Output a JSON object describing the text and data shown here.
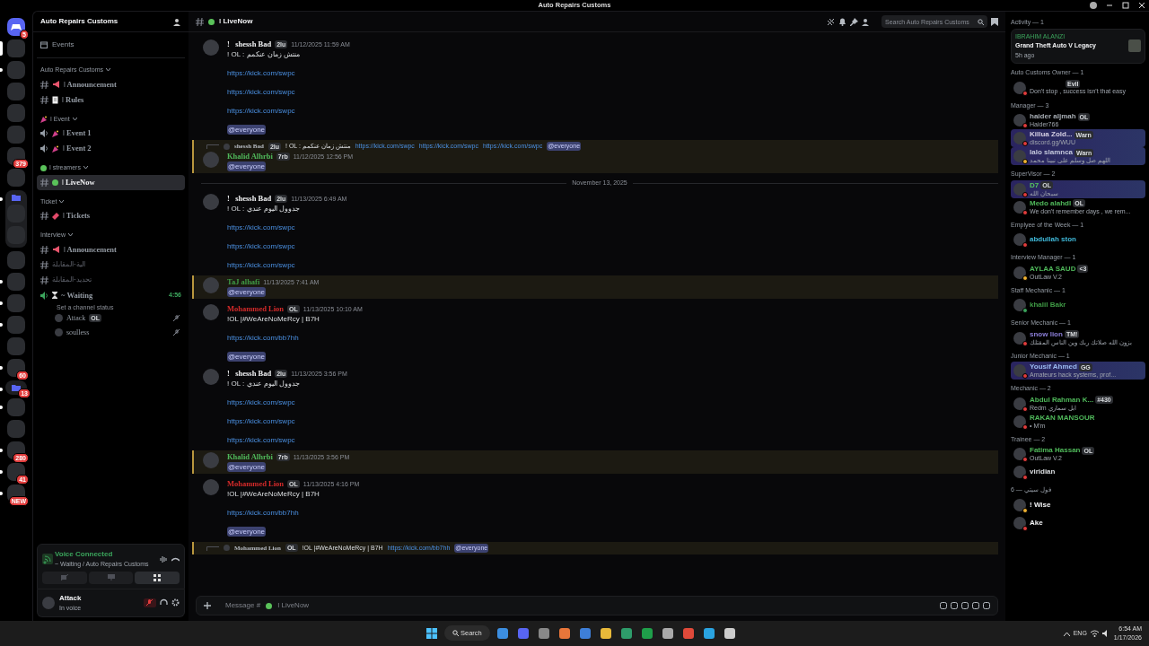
{
  "window": {
    "title": "Auto Repairs Customs"
  },
  "servers": [
    {
      "kind": "home",
      "badge": "5",
      "unread": false,
      "selected": false
    },
    {
      "kind": "server",
      "unread": false,
      "selected": true
    },
    {
      "kind": "server",
      "unread": true,
      "selected": false
    },
    {
      "kind": "server",
      "unread": false,
      "selected": false
    },
    {
      "kind": "server",
      "unread": false,
      "selected": false
    },
    {
      "kind": "server",
      "unread": false,
      "selected": false
    },
    {
      "kind": "server",
      "badge": "379",
      "unread": false,
      "selected": false
    },
    {
      "kind": "server",
      "unread": false,
      "selected": false
    },
    {
      "kind": "folder",
      "unread": true,
      "selected": false,
      "children": [
        {
          "kind": "server"
        },
        {
          "kind": "server"
        }
      ]
    },
    {
      "kind": "server",
      "unread": false,
      "selected": false
    },
    {
      "kind": "server",
      "unread": true,
      "selected": false
    },
    {
      "kind": "server",
      "unread": true,
      "selected": false
    },
    {
      "kind": "server",
      "unread": true,
      "selected": false
    },
    {
      "kind": "server",
      "unread": false,
      "selected": false
    },
    {
      "kind": "server",
      "badge": "60",
      "unread": true,
      "selected": false
    },
    {
      "kind": "folder",
      "badge": "13",
      "unread": true,
      "selected": false
    },
    {
      "kind": "server",
      "unread": true,
      "selected": false
    },
    {
      "kind": "server",
      "unread": false,
      "selected": false
    },
    {
      "kind": "server",
      "badge": "280",
      "unread": true,
      "selected": false
    },
    {
      "kind": "server",
      "badge": "41",
      "unread": true,
      "selected": false
    },
    {
      "kind": "server",
      "badge": "NEW",
      "unread": true,
      "selected": false
    }
  ],
  "sidebar": {
    "server_name": "Auto Repairs Customs",
    "events": "Events",
    "categories": [
      {
        "name": "Auto Repairs Customs",
        "channels": [
          {
            "kind": "text",
            "emoji": {
              "kind": "megaphone"
            },
            "name": "ǀ Announcement",
            "selected": false,
            "muted": false
          },
          {
            "kind": "text",
            "emoji": {
              "kind": "page"
            },
            "name": "ǀ Rules",
            "selected": false,
            "muted": false
          }
        ]
      },
      {
        "name": "ǀ Event",
        "emoji": {
          "kind": "party"
        },
        "channels": [
          {
            "kind": "voice",
            "emoji": {
              "kind": "party"
            },
            "name": "ǀ Event 1",
            "selected": false,
            "muted": false
          },
          {
            "kind": "voice",
            "emoji": {
              "kind": "party"
            },
            "name": "ǀ Event 2",
            "selected": false,
            "muted": false
          }
        ]
      },
      {
        "name": "ǀ streamers",
        "emoji": {
          "kind": "circle"
        },
        "channels": [
          {
            "kind": "text",
            "emoji": {
              "kind": "circle"
            },
            "name": "ǀ LiveNow",
            "selected": true,
            "muted": false
          }
        ]
      },
      {
        "name": "Ticket",
        "channels": [
          {
            "kind": "text",
            "emoji": {
              "kind": "ticket"
            },
            "name": "ǀ Tickets",
            "selected": false,
            "muted": false
          }
        ]
      },
      {
        "name": "Interview",
        "channels": [
          {
            "kind": "text",
            "emoji": {
              "kind": "megaphone"
            },
            "name": "ǀ Announcement",
            "selected": false,
            "muted": false
          },
          {
            "kind": "text",
            "name": "الية-المقابلة",
            "selected": false,
            "muted": true
          },
          {
            "kind": "text",
            "name": "تحديد-المقابلة",
            "selected": false,
            "muted": true
          },
          {
            "kind": "voice",
            "emoji": {
              "kind": "hourglass"
            },
            "name": "~ Waiting",
            "selected": false,
            "muted": false,
            "time": "4:56",
            "status": "Set a channel status",
            "users": [
              {
                "name": "Attack",
                "tag": "OL"
              },
              {
                "name": "soulless"
              }
            ]
          }
        ]
      }
    ],
    "voice": {
      "title": "Voice Connected",
      "where": "~ Waiting / Auto Repairs Customs"
    },
    "user": {
      "name": "Attack",
      "status": "In voice",
      "mic_muted": true
    }
  },
  "channel": {
    "name": "ǀ LiveNow"
  },
  "search": {
    "placeholder": "Search Auto Repairs Customs"
  },
  "messages": [
    {
      "kind": "message",
      "author": "!   shessh Bad",
      "color": "#f2f3f5",
      "tag": "2lu",
      "time": "11/12/2025 11:59 AM",
      "highlighted": false,
      "blocks": [
        {
          "kind": "text",
          "text": "! OL : منتش زمان عنكمم"
        },
        {
          "kind": "link",
          "text": "https://kick.com/swpc"
        },
        {
          "kind": "link",
          "text": "https://kick.com/swpc"
        },
        {
          "kind": "link",
          "text": "https://kick.com/swpc"
        },
        {
          "kind": "mention",
          "text": "@everyone"
        }
      ]
    },
    {
      "kind": "message",
      "author": "Khalid Alhrbi",
      "color": "#4fb85a",
      "tag": "7rb",
      "time": "11/12/2025 12:56 PM",
      "highlighted": true,
      "reply": {
        "author": "shessh Bad",
        "tag": "2lu",
        "parts": [
          {
            "kind": "text",
            "text": "! OL : منتش زمان عنكمم"
          },
          {
            "kind": "link",
            "text": "https://kick.com/swpc"
          },
          {
            "kind": "link",
            "text": "https://kick.com/swpc"
          },
          {
            "kind": "link",
            "text": "https://kick.com/swpc"
          },
          {
            "kind": "mention",
            "text": "@everyone"
          }
        ]
      },
      "blocks": [
        {
          "kind": "mention",
          "text": "@everyone"
        }
      ]
    },
    {
      "kind": "divider",
      "text": "November 13, 2025"
    },
    {
      "kind": "message",
      "author": "!   shessh Bad",
      "color": "#f2f3f5",
      "tag": "2lu",
      "time": "11/13/2025 6:49 AM",
      "highlighted": false,
      "blocks": [
        {
          "kind": "text",
          "text": "! OL : جدوول اليوم عندي"
        },
        {
          "kind": "link",
          "text": "https://kick.com/swpc"
        },
        {
          "kind": "link",
          "text": "https://kick.com/swpc"
        },
        {
          "kind": "link",
          "text": "https://kick.com/swpc"
        }
      ]
    },
    {
      "kind": "message",
      "author": "TaJ alhafi",
      "color": "#3f9a45",
      "time": "11/13/2025 7:41 AM",
      "highlighted": true,
      "blocks": [
        {
          "kind": "mention",
          "text": "@everyone"
        }
      ]
    },
    {
      "kind": "message",
      "author": "Mohammed Lion",
      "color": "#d42a2a",
      "tag": "OL",
      "time": "11/13/2025 10:10 AM",
      "highlighted": false,
      "blocks": [
        {
          "kind": "text",
          "text": "!OL |#WeAreNoMeRcy | B7H"
        },
        {
          "kind": "link",
          "text": "https://kick.com/bb7hh"
        },
        {
          "kind": "mention",
          "text": "@everyone"
        }
      ]
    },
    {
      "kind": "message",
      "author": "!   shessh Bad",
      "color": "#f2f3f5",
      "tag": "2lu",
      "time": "11/13/2025 3:56 PM",
      "highlighted": false,
      "blocks": [
        {
          "kind": "text",
          "text": "! OL : جدوول اليوم عندي"
        },
        {
          "kind": "link",
          "text": "https://kick.com/swpc"
        },
        {
          "kind": "link",
          "text": "https://kick.com/swpc"
        },
        {
          "kind": "link",
          "text": "https://kick.com/swpc"
        }
      ]
    },
    {
      "kind": "message",
      "author": "Khalid Alhrbi",
      "color": "#4fb85a",
      "tag": "7rb",
      "time": "11/13/2025 3:56 PM",
      "highlighted": true,
      "blocks": [
        {
          "kind": "mention",
          "text": "@everyone"
        }
      ]
    },
    {
      "kind": "message",
      "author": "Mohammed Lion",
      "color": "#d42a2a",
      "tag": "OL",
      "time": "11/13/2025 4:16 PM",
      "highlighted": false,
      "blocks": [
        {
          "kind": "text",
          "text": "!OL |#WeAreNoMeRcy | B7H"
        },
        {
          "kind": "link",
          "text": "https://kick.com/bb7hh"
        },
        {
          "kind": "mention",
          "text": "@everyone"
        }
      ]
    },
    {
      "kind": "reply_stub",
      "highlighted": true,
      "reply": {
        "author": "Mohammed Lion",
        "tag": "OL",
        "parts": [
          {
            "kind": "text",
            "text": "!OL |#WeAreNoMeRcy | B7H"
          },
          {
            "kind": "link",
            "text": "https://kick.com/bb7hh"
          },
          {
            "kind": "mention",
            "text": "@everyone"
          }
        ]
      }
    }
  ],
  "composer": {
    "prefix": "Message #",
    "channel": "ǀ LiveNow"
  },
  "members": {
    "activity": {
      "title": "Activity — 1",
      "user": "IBRAHIM ALANZI",
      "game": "Grand Theft Auto V Legacy",
      "time": "5h ago"
    },
    "groups": [
      {
        "title": "Auto Customs Owner — 1",
        "members": [
          {
            "tag": "Evil",
            "status": "Don't stop , success isn't that easy",
            "presence": {
              "kind": "dnd"
            },
            "nameplate": false
          }
        ]
      },
      {
        "title": "Manager — 3",
        "members": [
          {
            "name": "haider aljmah",
            "color": "#a7adb4",
            "tag": "OL",
            "status": "Haider766",
            "presence": {
              "kind": "dnd"
            },
            "nameplate": false
          },
          {
            "name": "Killua Zold...",
            "color": "#d6d0e4",
            "tag": "Warn",
            "status": "discord.gg/WUU",
            "presence": {
              "kind": "dnd"
            },
            "nameplate": true
          },
          {
            "name": "lalo slamnca",
            "color": "#c4c8dc",
            "tag": "Warn",
            "status": "اللهم صل وسلم على نبينا محمد",
            "presence": {
              "kind": "idle"
            },
            "nameplate": true
          }
        ]
      },
      {
        "title": "SuperVisor — 2",
        "members": [
          {
            "name": "D7",
            "color": "#57c85f",
            "tag": "OL",
            "status": "سبحان الله",
            "presence": {
              "kind": "dnd"
            },
            "nameplate": true
          },
          {
            "name": "Medo alahdl",
            "color": "#4fb85a",
            "tag": "OL",
            "status": "We don't remember days , we rem...",
            "presence": {
              "kind": "dnd"
            },
            "nameplate": false
          }
        ]
      },
      {
        "title": "Emplyee of the Week — 1",
        "members": [
          {
            "name": "abdullah ston",
            "color": "#3fb8d8",
            "presence": {
              "kind": "dnd"
            },
            "nameplate": false
          }
        ]
      },
      {
        "title": "Interview Manager — 1",
        "members": [
          {
            "name": "AYLAA SAUD",
            "color": "#4fb85a",
            "tag": "<3",
            "status": "OutLaw V.2",
            "presence": {
              "kind": "idle"
            },
            "nameplate": false
          }
        ]
      },
      {
        "title": "Staff Mechanic — 1",
        "members": [
          {
            "name": "khalil Bakr",
            "color": "#3f9a45",
            "presence": {
              "kind": "online"
            },
            "nameplate": false
          }
        ]
      },
      {
        "title": "Senior Mechanic — 1",
        "members": [
          {
            "name": "snow lion",
            "color": "#8a7dd6",
            "tag": "TM!",
            "status": "بزون الله صلاتك ربك وين الناس المقتلك",
            "presence": {
              "kind": "dnd"
            },
            "nameplate": false
          }
        ]
      },
      {
        "title": "Junior Mechanic — 1",
        "members": [
          {
            "name": "Yousif Ahmed",
            "color": "#9bbaf0",
            "tag": "GG",
            "status": "Amateurs hack systems, prof...",
            "presence": {
              "kind": "dnd"
            },
            "nameplate": true
          }
        ]
      },
      {
        "title": "Mechanic — 2",
        "members": [
          {
            "name": "Abdul Rahman K...",
            "color": "#4fb85a",
            "tag": "#430",
            "status": "Redm ابل سماري",
            "presence": {
              "kind": "dnd"
            },
            "nameplate": false
          },
          {
            "name": "RAKAN MANSOUR",
            "color": "#4fb85a",
            "status": "• M'm",
            "presence": {
              "kind": "dnd"
            },
            "nameplate": false
          }
        ]
      },
      {
        "title": "Trainee — 2",
        "members": [
          {
            "name": "Fatima Hassan",
            "color": "#4fb85a",
            "tag": "OL",
            "status": "OutLaw V.2",
            "presence": {
              "kind": "dnd"
            },
            "nameplate": false
          },
          {
            "name": "viridian",
            "color": "#dbdee1",
            "presence": {
              "kind": "dnd"
            },
            "nameplate": false
          }
        ]
      },
      {
        "title": "فول سيتي — 6",
        "members": [
          {
            "name": "! Wise",
            "color": "#f2f3f5",
            "presence": {
              "kind": "idle"
            },
            "nameplate": false
          },
          {
            "name": "Ake",
            "color": "#f2f3f5",
            "presence": {
              "kind": "dnd"
            },
            "nameplate": false
          }
        ]
      }
    ]
  },
  "taskbar": {
    "search": "Search",
    "lang": "ENG",
    "time": "6:54 AM",
    "date": "1/17/2026"
  }
}
